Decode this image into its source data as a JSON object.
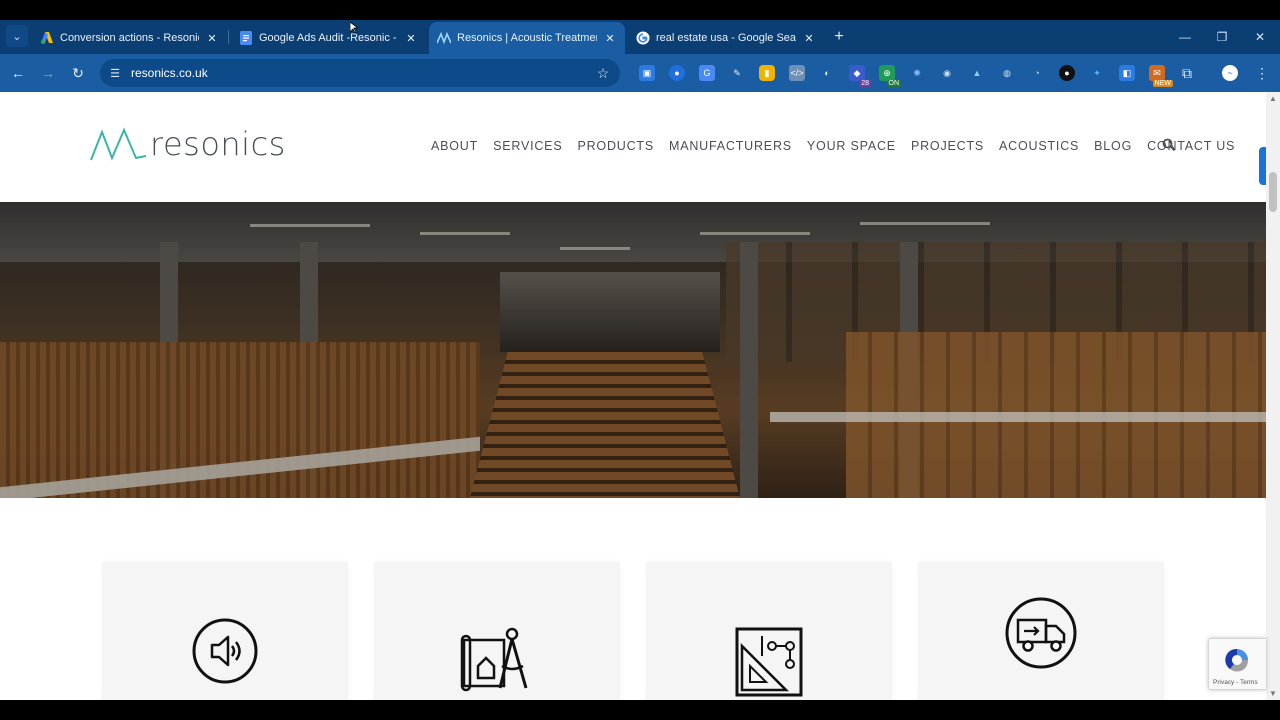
{
  "browser": {
    "tabs": [
      {
        "title": "Conversion actions - Resonics",
        "icon": "google-ads-icon",
        "active": false
      },
      {
        "title": "Google Ads Audit -Resonic - Go",
        "icon": "google-docs-icon",
        "active": false
      },
      {
        "title": "Resonics | Acoustic Treatment S",
        "icon": "resonics-favicon-icon",
        "active": true
      },
      {
        "title": "real estate usa - Google Search",
        "icon": "google-icon",
        "active": false
      }
    ],
    "address": "resonics.co.uk",
    "extension_badges": {
      "count": "28",
      "on": "ON",
      "new": "NEW"
    },
    "colors": {
      "tabbar": "#0b3f74",
      "toolbar": "#1a5da3"
    }
  },
  "site": {
    "logo_text": "resonics",
    "logo_color": "#3ab5a5",
    "nav": [
      "ABOUT",
      "SERVICES",
      "PRODUCTS",
      "MANUFACTURERS",
      "YOUR SPACE",
      "PROJECTS",
      "ACOUSTICS",
      "BLOG",
      "CONTACT US"
    ],
    "cards": [
      {
        "icon": "speaker-icon"
      },
      {
        "icon": "blueprint-compass-icon"
      },
      {
        "icon": "set-square-plan-icon"
      },
      {
        "icon": "delivery-truck-icon"
      }
    ]
  },
  "recaptcha": {
    "links": "Privacy - Terms"
  }
}
